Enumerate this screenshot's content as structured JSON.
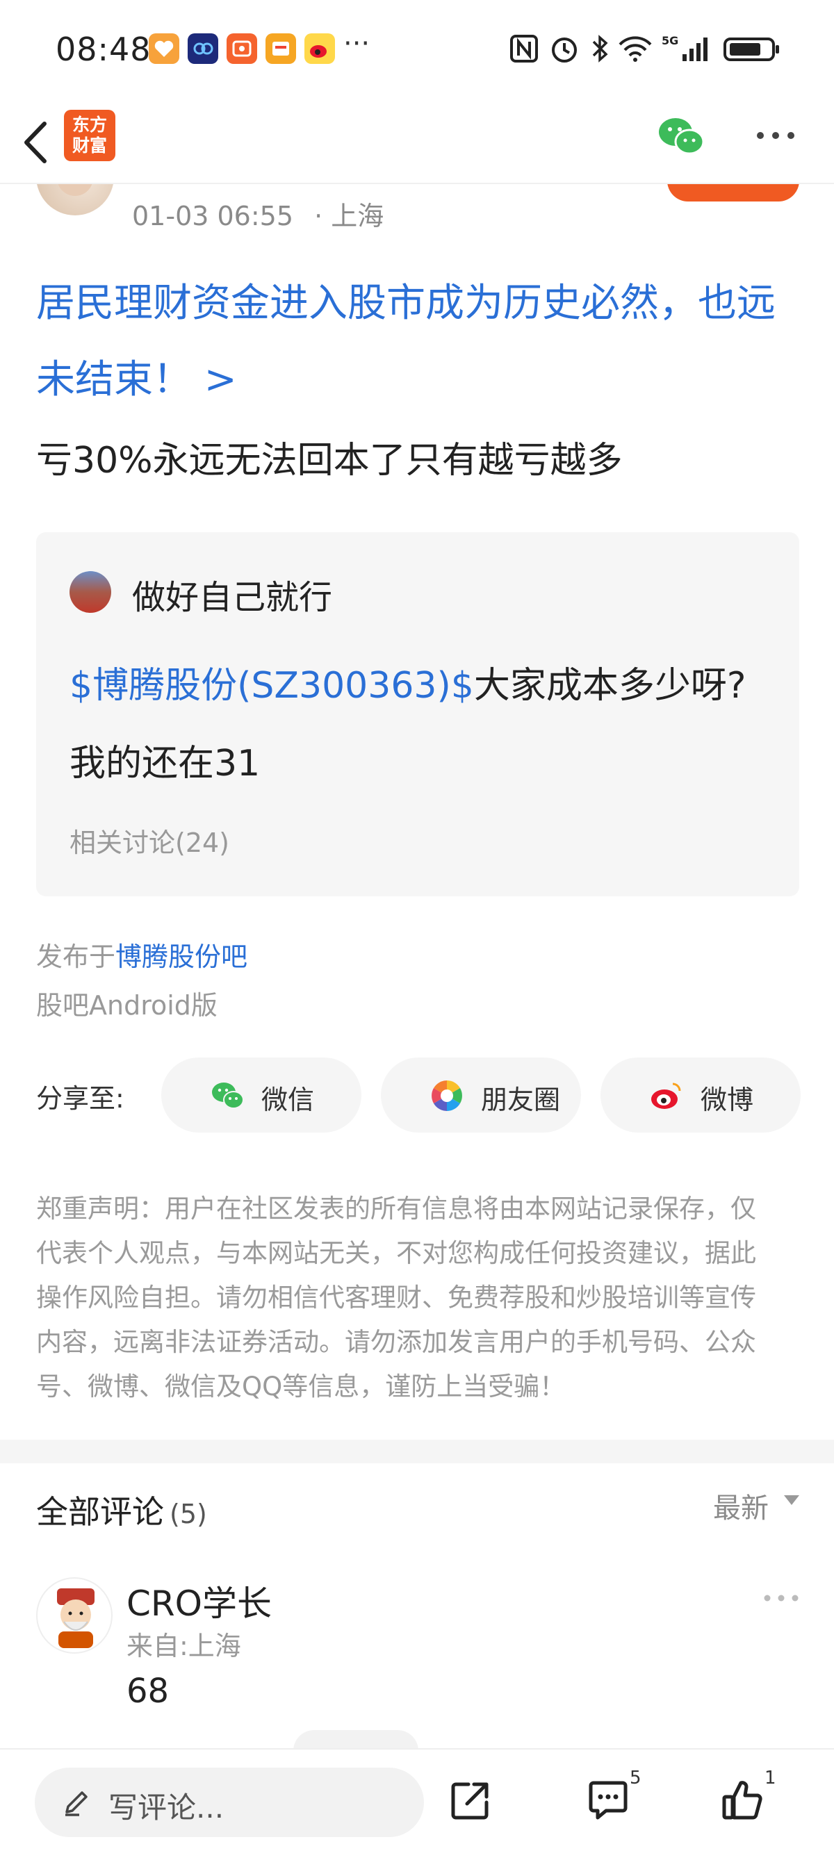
{
  "status_bar": {
    "time": "08:48",
    "more_indicator": "···",
    "app_icons": [
      "heart-app-icon",
      "cq-app-icon",
      "video-app-icon",
      "wallet-app-icon",
      "weibo-app-icon"
    ],
    "system_icons": [
      "nfc-icon",
      "alarm-icon",
      "bluetooth-icon",
      "wifi-icon",
      "5g-signal-icon",
      "battery-icon"
    ]
  },
  "nav": {
    "logo_text": "东方财富",
    "logo_line1": "东方",
    "logo_line2": "财富",
    "icons": [
      "back-icon",
      "wechat-icon",
      "more-icon"
    ]
  },
  "post": {
    "meta_time": "01-03 06:55",
    "meta_location": "· 上海",
    "headline_line1": "居民理财资金进入股市成为历史必然，也远",
    "headline_line2": "未结束！ >",
    "body": "亏30%永远无法回本了只有越亏越多",
    "quote": {
      "author": "做好自己就行",
      "stock_tag": "$博腾股份(SZ300363)$",
      "text_after_tag": "大家成本多少呀?",
      "line2": "我的还在31",
      "related": "相关讨论(24)"
    },
    "published_prefix": "发布于",
    "published_bar": "博腾股份吧",
    "client": "股吧Android版"
  },
  "share": {
    "label": "分享至:",
    "buttons": [
      {
        "label": "微信",
        "icon": "wechat-icon"
      },
      {
        "label": "朋友圈",
        "icon": "moments-icon"
      },
      {
        "label": "微博",
        "icon": "weibo-icon"
      }
    ]
  },
  "disclaimer_lines": [
    "郑重声明：用户在社区发表的所有信息将由本网站记录保存，仅",
    "代表个人观点，与本网站无关，不对您构成任何投资建议，据此",
    "操作风险自担。请勿相信代客理财、免费荐股和炒股培训等宣传",
    "内容，远离非法证券活动。请勿添加发言用户的手机号码、公众",
    "号、微博、微信及QQ等信息，谨防上当受骗！"
  ],
  "comments": {
    "title": "全部评论",
    "count": "(5)",
    "sort_label": "最新",
    "items": [
      {
        "author": "CRO学长",
        "from": "来自:上海",
        "text": "68"
      }
    ]
  },
  "bottom_bar": {
    "placeholder": "写评论...",
    "comment_count": "5",
    "like_count": "1",
    "icons": [
      "share-out-icon",
      "comment-icon",
      "like-icon"
    ]
  },
  "colors": {
    "accent_blue": "#2a6fd6",
    "brand_orange": "#f05a22",
    "muted_gray": "#999999"
  }
}
